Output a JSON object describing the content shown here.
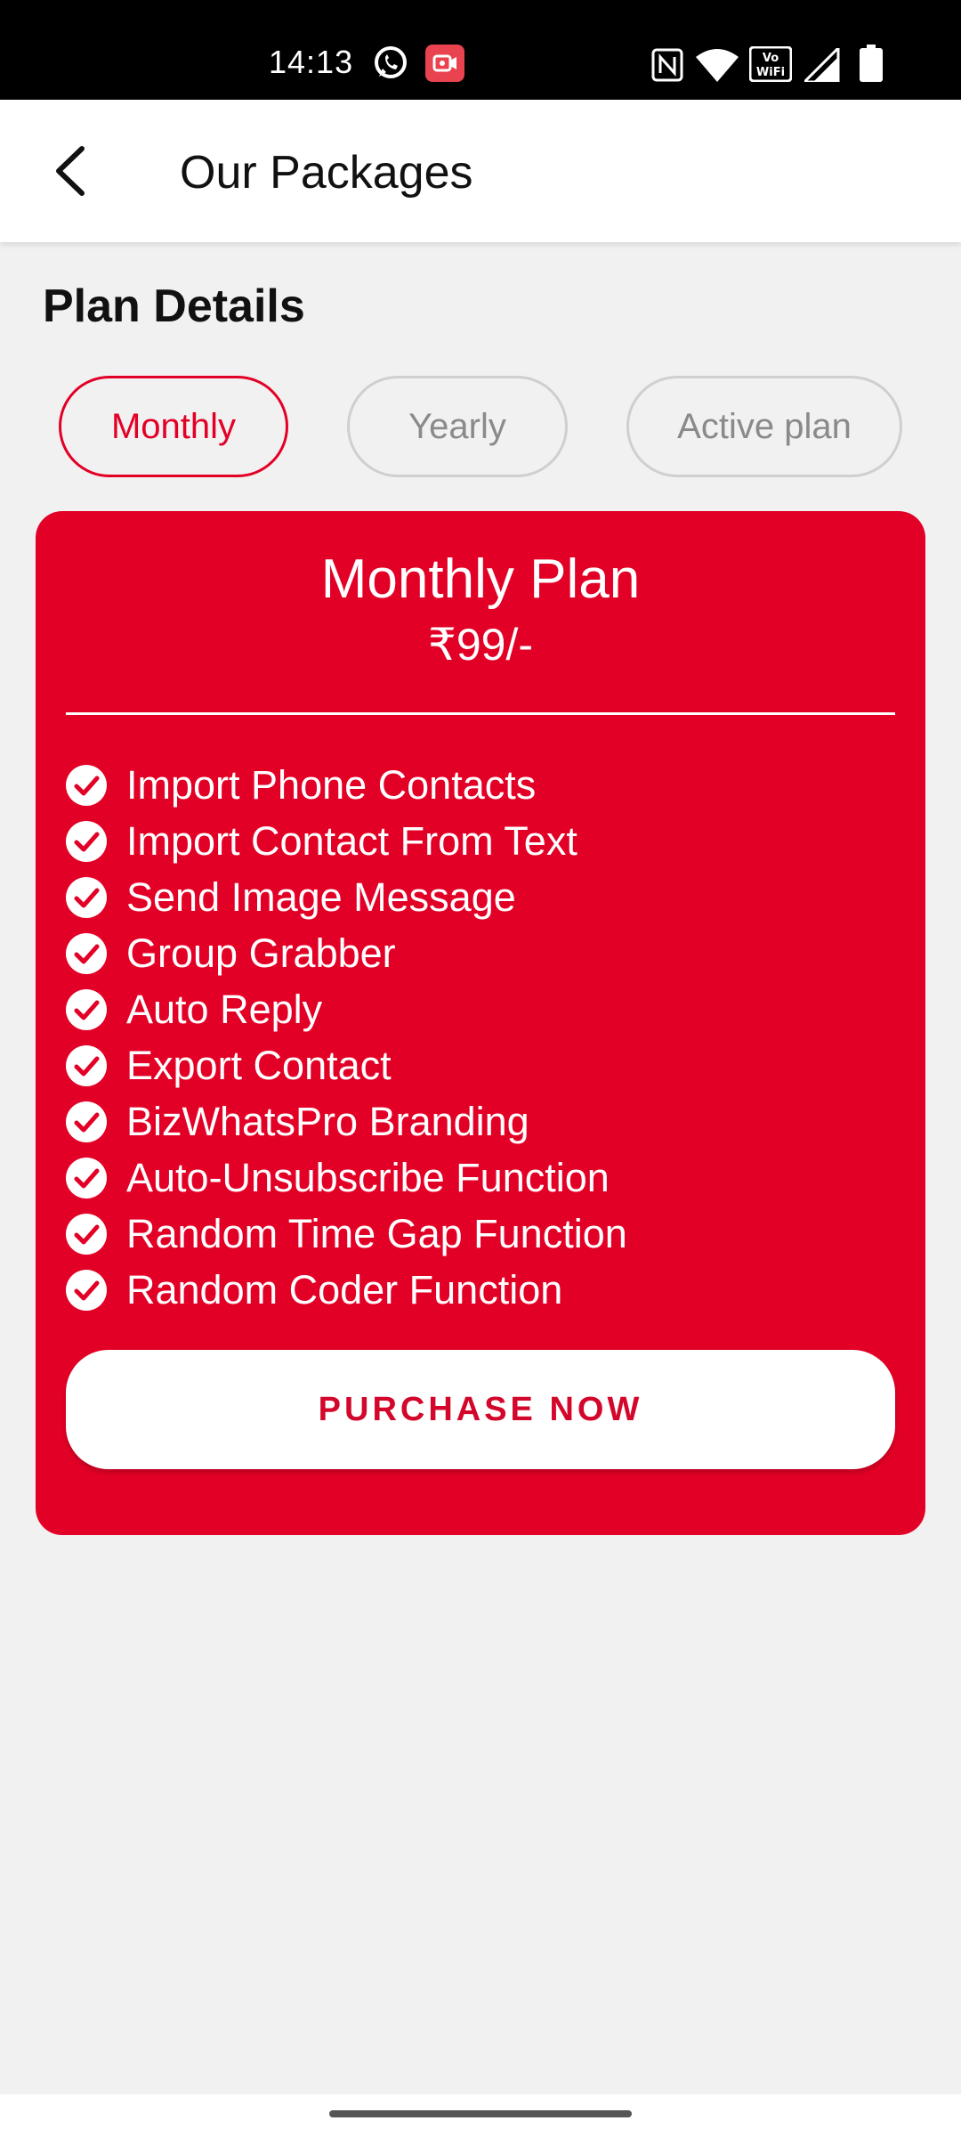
{
  "status_bar": {
    "time": "14:13",
    "icons": [
      "whatsapp-icon",
      "screen-record-icon",
      "nfc-icon",
      "wifi-icon",
      "vowifi-icon",
      "signal-icon",
      "battery-icon"
    ]
  },
  "app_bar": {
    "back_icon": "arrow-back-icon",
    "title": "Our Packages"
  },
  "section_title": "Plan Details",
  "tabs": [
    {
      "label": "Monthly",
      "active": true
    },
    {
      "label": "Yearly",
      "active": false
    },
    {
      "label": "Active plan",
      "active": false
    }
  ],
  "plan": {
    "title": "Monthly Plan",
    "price": "₹99/-",
    "features": [
      "Import Phone Contacts",
      "Import Contact From Text",
      "Send Image Message",
      "Group Grabber",
      "Auto Reply",
      "Export Contact",
      "BizWhatsPro Branding",
      "Auto-Unsubscribe Function",
      "Random Time Gap Function",
      "Random Coder Function"
    ],
    "feature_icon": "check-circle-icon",
    "purchase_label": "PURCHASE NOW"
  },
  "colors": {
    "accent": "#e30026",
    "background": "#f1f1f1",
    "status_bar": "#000000"
  }
}
